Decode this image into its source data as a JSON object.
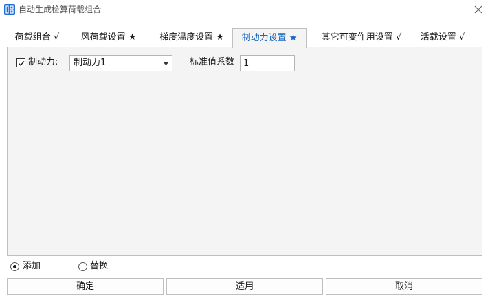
{
  "window": {
    "title": "自动生成检算荷载组合",
    "icon": "app-grid-icon",
    "close_icon": "close-icon"
  },
  "tabs": [
    {
      "label": "荷载组合 √"
    },
    {
      "label": "风荷载设置 ★"
    },
    {
      "label": "梯度温度设置 ★"
    },
    {
      "label": "制动力设置 ★",
      "active": true
    },
    {
      "label": "其它可变作用设置 √"
    },
    {
      "label": "活载设置 √"
    }
  ],
  "panel": {
    "braking_checked": true,
    "braking_label": "制动力:",
    "braking_select_value": "制动力1",
    "coefficient_label": "标准值系数",
    "coefficient_value": "1"
  },
  "mode": {
    "add_label": "添加",
    "replace_label": "替换",
    "selected": "添加"
  },
  "buttons": {
    "ok": "确定",
    "apply": "适用",
    "cancel": "取消"
  },
  "colors": {
    "active_tab_text": "#1565c0",
    "app_icon": "#1e6fd9",
    "panel_bg": "#f4f4f4"
  }
}
